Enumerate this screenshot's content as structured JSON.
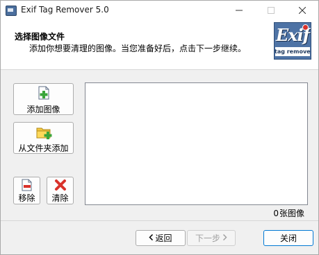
{
  "window": {
    "title": "Exif Tag Remover 5.0"
  },
  "header": {
    "title": "选择图像文件",
    "subtitle": "添加你想要清理的图像。当您准备好后，点击下一步继续。",
    "logo_word": "Exif",
    "logo_tag": "tag remover"
  },
  "tools": {
    "add_images": {
      "label": "添加图像",
      "icon": "add-file-icon"
    },
    "add_folder": {
      "label": "从文件夹添加",
      "icon": "add-folder-icon"
    },
    "remove": {
      "label": "移除",
      "icon": "remove-file-icon"
    },
    "clear": {
      "label": "清除",
      "icon": "clear-x-icon"
    }
  },
  "image_list": {
    "items": [],
    "count": "0",
    "count_unit": "张图像"
  },
  "footer": {
    "back_label": "返回",
    "next_label": "下一步",
    "close_label": "关闭"
  },
  "colors": {
    "accent": "#0078d4",
    "logo_bg": "#4e73a5",
    "add_green": "#3aa53a",
    "clear_red": "#d9322b"
  }
}
